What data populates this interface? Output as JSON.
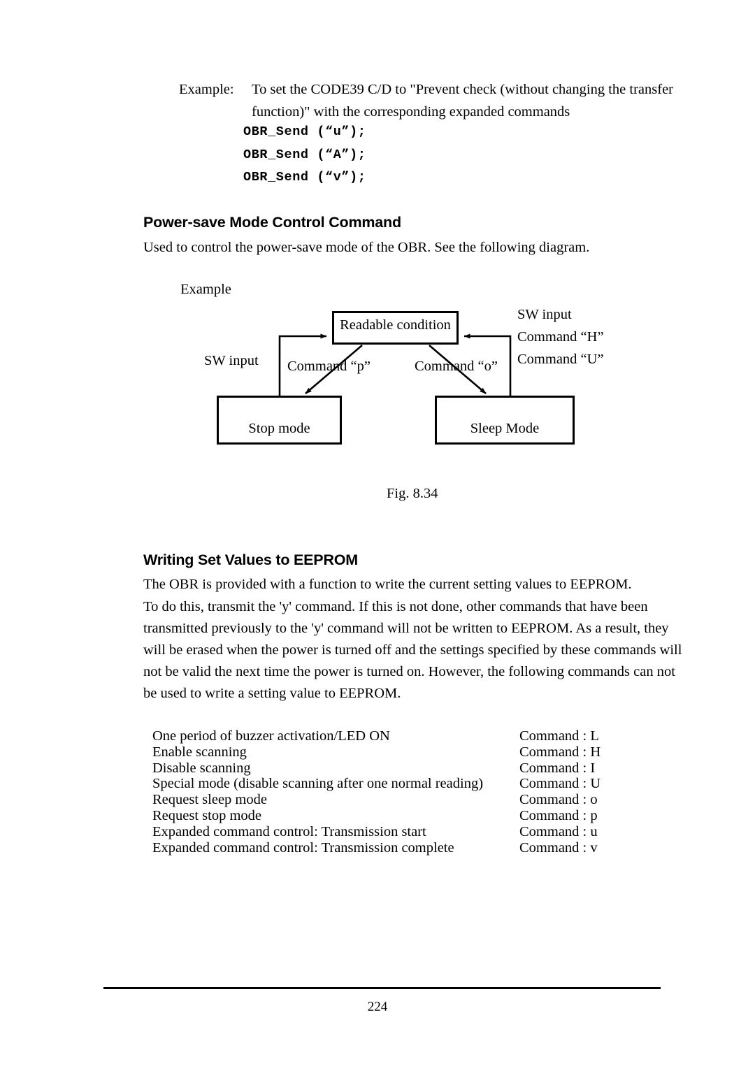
{
  "example_block": {
    "label": "Example:",
    "line1": "To set the CODE39 C/D to \"Prevent check (without changing the transfer",
    "line2": "function)\" with the corresponding expanded commands",
    "commands": [
      "OBR_Send (“u”);",
      "OBR_Send (“A”);",
      "OBR_Send (“v”);"
    ]
  },
  "section_powersave": {
    "heading": "Power-save Mode Control Command",
    "description": "Used to control the power-save mode of the OBR. See the following diagram.",
    "example_label": "Example",
    "figure_caption": "Fig. 8.34",
    "diagram": {
      "boxes": {
        "readable": "Readable condition",
        "stop": "Stop mode",
        "sleep": "Sleep Mode"
      },
      "labels": {
        "sw_input_left": "SW input",
        "sw_input_right": "SW input",
        "command_h": "Command “H”",
        "command_u": "Command “U”",
        "command_p": "Command “p”",
        "command_o": "Command “o”"
      }
    }
  },
  "section_eeprom": {
    "heading": "Writing Set Values to EEPROM",
    "description": "The OBR is provided with a function to write the current setting values to EEPROM.",
    "paragraph": "To do this, transmit the 'y' command. If this is not done, other commands that have been transmitted previously to the 'y' command will not be written to EEPROM. As a result, they will be erased when the power is turned off and the settings specified by these commands will not be valid the next time the power is turned on. However, the following commands can not be used to write a setting value to EEPROM.",
    "command_list": [
      {
        "description": "One period of buzzer activation/LED ON",
        "command": "Command : L"
      },
      {
        "description": "Enable scanning",
        "command": "Command : H"
      },
      {
        "description": "Disable scanning",
        "command": "Command : I"
      },
      {
        "description": "Special mode (disable scanning after one normal reading)",
        "command": "Command : U"
      },
      {
        "description": "Request sleep mode",
        "command": "Command : o"
      },
      {
        "description": "Request stop mode",
        "command": "Command : p"
      },
      {
        "description": "Expanded command control: Transmission start",
        "command": "Command : u"
      },
      {
        "description": "Expanded command control: Transmission complete",
        "command": "Command : v"
      }
    ]
  },
  "footer": {
    "page_number": "224"
  }
}
